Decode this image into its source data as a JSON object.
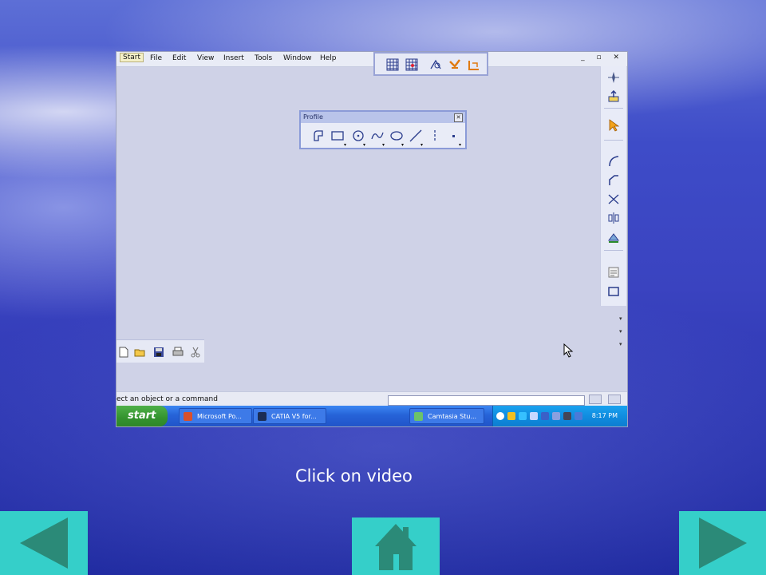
{
  "slide": {
    "caption": "Click on video"
  },
  "video_screenshot": {
    "menu": [
      "Start",
      "File",
      "Edit",
      "View",
      "Insert",
      "Tools",
      "Window",
      "Help"
    ],
    "window_controls": "_ ▫ ✕",
    "profile_toolbar": {
      "title": "Profile",
      "close": "✕",
      "icons": [
        "profile-icon",
        "rectangle-icon",
        "circle-icon",
        "spline-icon",
        "ellipse-icon",
        "line-icon",
        "axis-icon",
        "point-icon"
      ]
    },
    "status_bar": {
      "prompt": "ect an object or a command"
    },
    "taskbar": {
      "start_label": "start",
      "buttons": [
        {
          "label": "Microsoft Po...",
          "icon": "powerpoint-icon",
          "color": "#d9502c"
        },
        {
          "label": "CATIA V5 for...",
          "icon": "catia-icon",
          "color": "#1b2d55"
        },
        {
          "label": "Camtasia Stu...",
          "icon": "camtasia-icon",
          "color": "#6cc36a"
        }
      ],
      "clock": "8:17 PM"
    }
  },
  "navigation": {
    "back_icon": "triangle-left-icon",
    "home_icon": "house-icon",
    "forward_icon": "triangle-right-icon",
    "button_color": "#35cfc9",
    "arrow_color": "#2b8a78"
  }
}
